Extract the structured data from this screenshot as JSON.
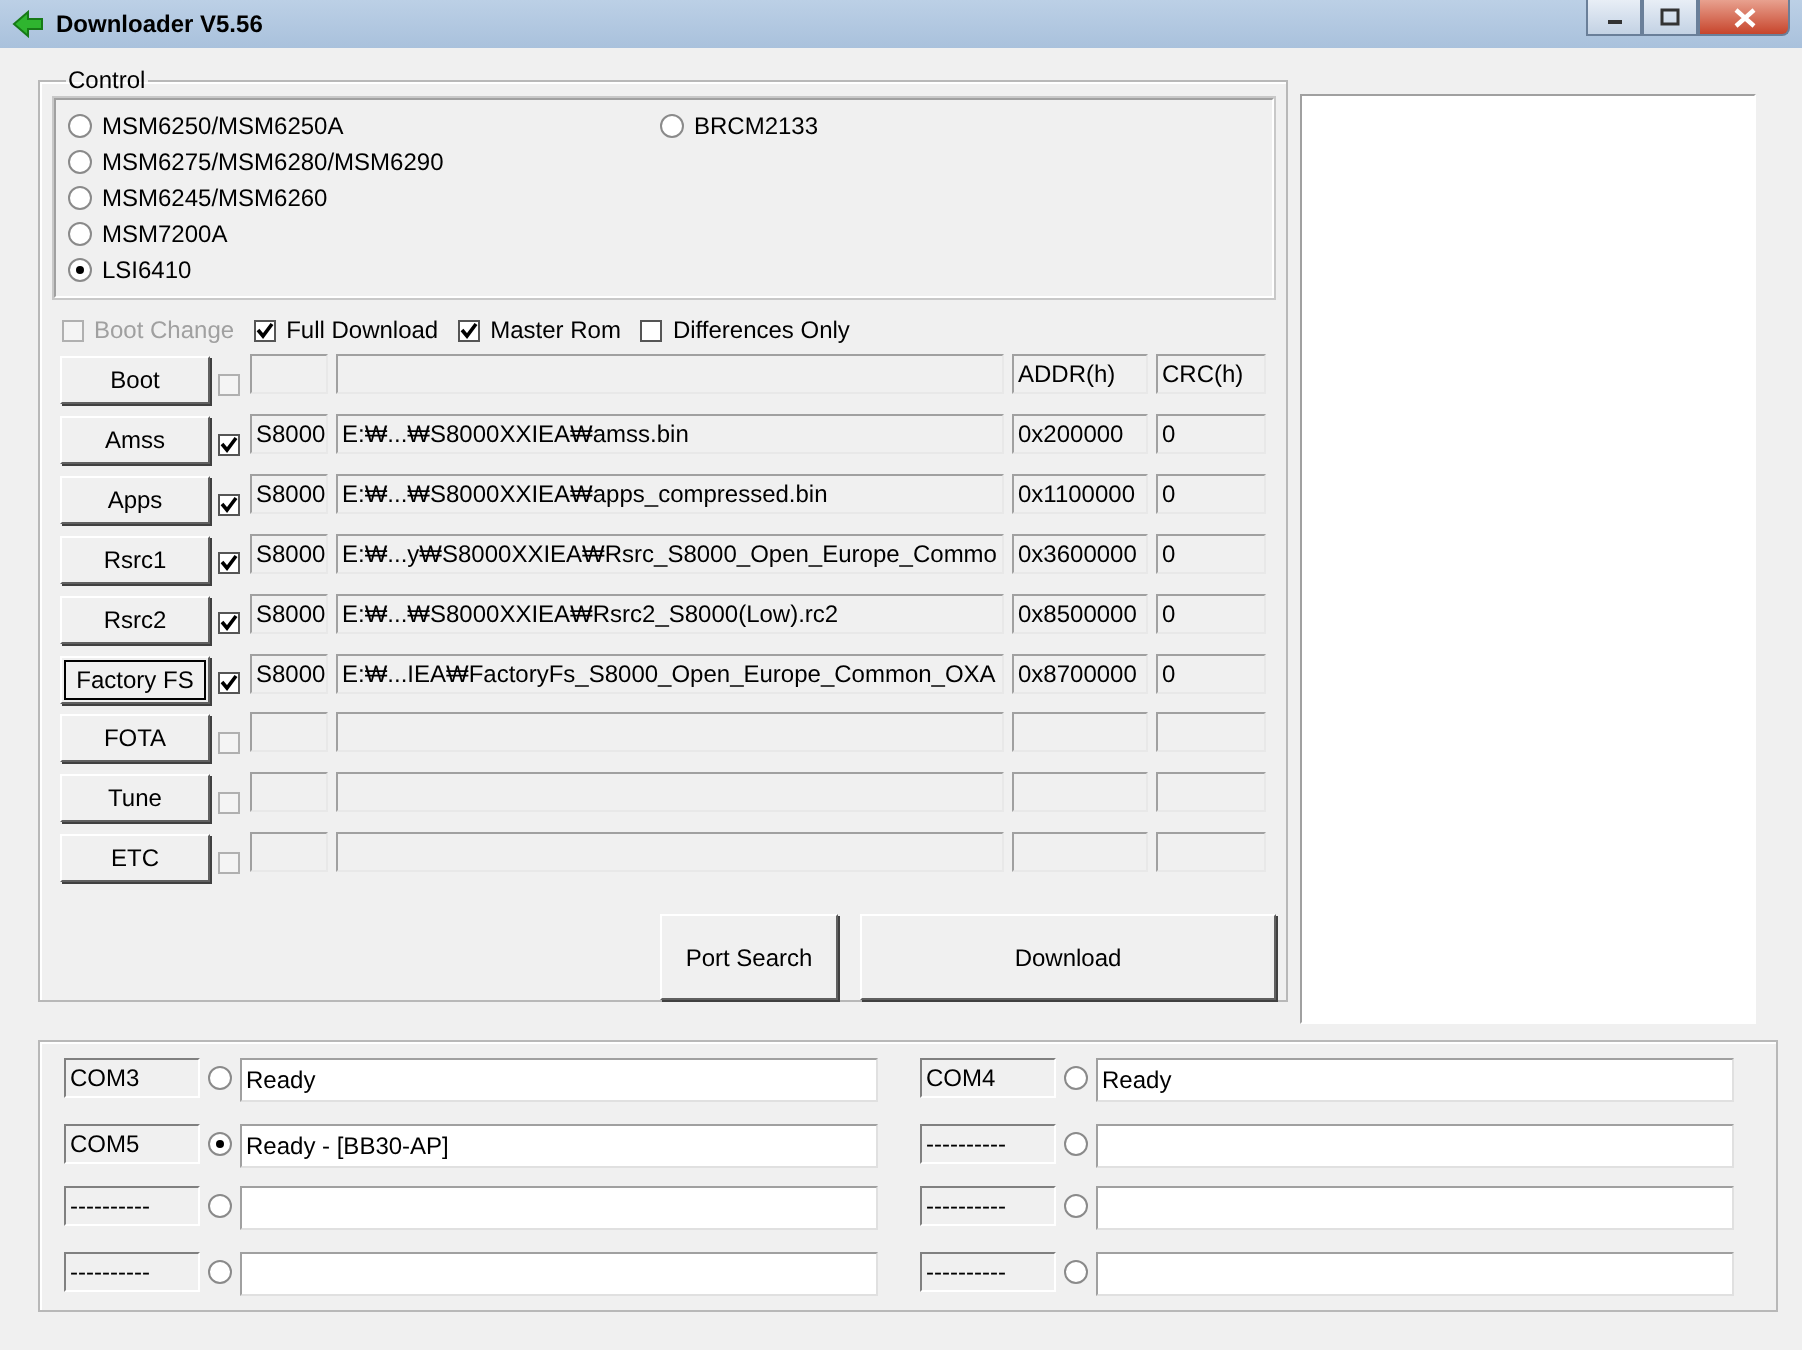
{
  "window": {
    "title": "Downloader V5.56"
  },
  "control": {
    "label": "Control",
    "chipsets": [
      {
        "label": "MSM6250/MSM6250A",
        "selected": false
      },
      {
        "label": "MSM6275/MSM6280/MSM6290",
        "selected": false
      },
      {
        "label": "MSM6245/MSM6260",
        "selected": false
      },
      {
        "label": "MSM7200A",
        "selected": false
      },
      {
        "label": "LSI6410",
        "selected": true
      },
      {
        "label": "BRCM2133",
        "selected": false
      }
    ]
  },
  "options": [
    {
      "label": "Boot Change",
      "checked": false,
      "disabled": true
    },
    {
      "label": "Full Download",
      "checked": true,
      "disabled": false
    },
    {
      "label": "Master Rom",
      "checked": true,
      "disabled": false
    },
    {
      "label": "Differences Only",
      "checked": false,
      "disabled": false
    }
  ],
  "files": [
    {
      "button": "Boot",
      "focused": false,
      "checked": false,
      "addr": "ADDR(h)",
      "crc": "CRC(h)"
    },
    {
      "button": "Amss",
      "focused": false,
      "checked": true,
      "model": "S8000",
      "path": "E:₩...₩S8000XXIEA₩amss.bin",
      "addr": "0x200000",
      "crc": "0"
    },
    {
      "button": "Apps",
      "focused": false,
      "checked": true,
      "model": "S8000",
      "path": "E:₩...₩S8000XXIEA₩apps_compressed.bin",
      "addr": "0x1100000",
      "crc": "0"
    },
    {
      "button": "Rsrc1",
      "focused": false,
      "checked": true,
      "model": "S8000",
      "path": "E:₩...y₩S8000XXIEA₩Rsrc_S8000_Open_Europe_Commo",
      "addr": "0x3600000",
      "crc": "0"
    },
    {
      "button": "Rsrc2",
      "focused": false,
      "checked": true,
      "model": "S8000",
      "path": "E:₩...₩S8000XXIEA₩Rsrc2_S8000(Low).rc2",
      "addr": "0x8500000",
      "crc": "0"
    },
    {
      "button": "Factory FS",
      "focused": true,
      "checked": true,
      "model": "S8000",
      "path": "E:₩...IEA₩FactoryFs_S8000_Open_Europe_Common_OXA",
      "addr": "0x8700000",
      "crc": "0"
    },
    {
      "button": "FOTA",
      "focused": false,
      "checked": false
    },
    {
      "button": "Tune",
      "focused": false,
      "checked": false
    },
    {
      "button": "ETC",
      "focused": false,
      "checked": false
    }
  ],
  "actions": [
    "Port Search",
    "Download"
  ],
  "ports": [
    {
      "port": "COM3",
      "selected": false,
      "status": "Ready"
    },
    {
      "port": "COM4",
      "selected": false,
      "status": "Ready"
    },
    {
      "port": "COM5",
      "selected": true,
      "status": "Ready - [BB30-AP]"
    },
    {
      "port": "----------",
      "selected": false
    },
    {
      "port": "----------",
      "selected": false
    },
    {
      "port": "----------",
      "selected": false
    },
    {
      "port": "----------",
      "selected": false
    },
    {
      "port": "----------",
      "selected": false
    }
  ]
}
